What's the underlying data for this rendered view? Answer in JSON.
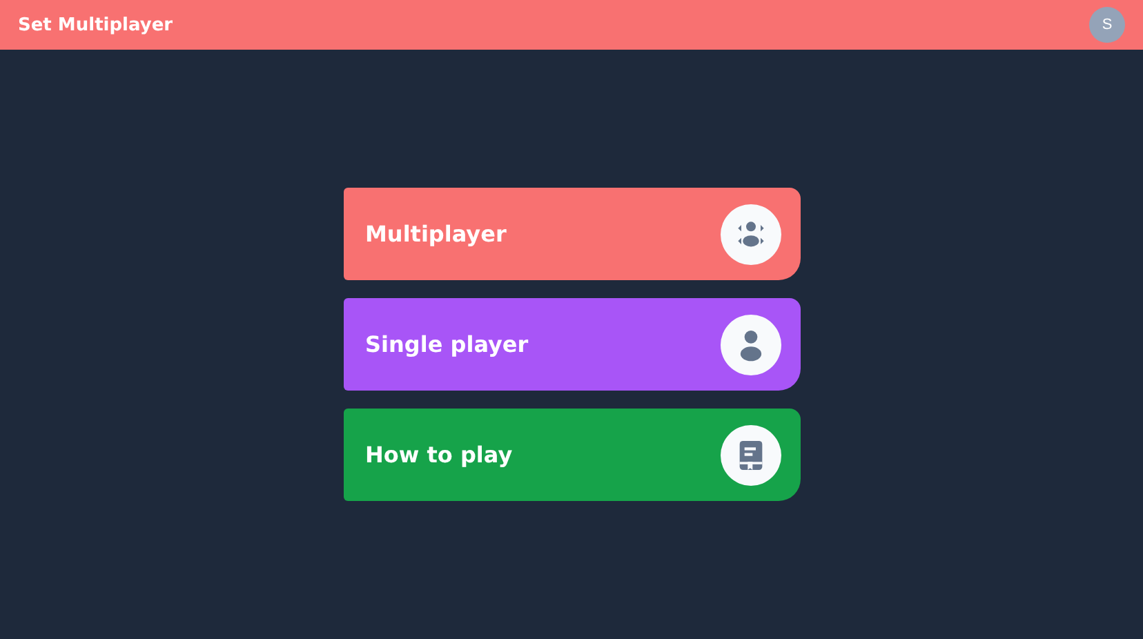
{
  "header": {
    "title": "Set Multiplayer",
    "avatar": "S"
  },
  "options": [
    {
      "label": "Multiplayer",
      "kind": "group",
      "color": "#f87171"
    },
    {
      "label": "Single player",
      "kind": "person",
      "color": "#a855f7"
    },
    {
      "label": "How to play",
      "kind": "book",
      "color": "#16a34a"
    }
  ]
}
